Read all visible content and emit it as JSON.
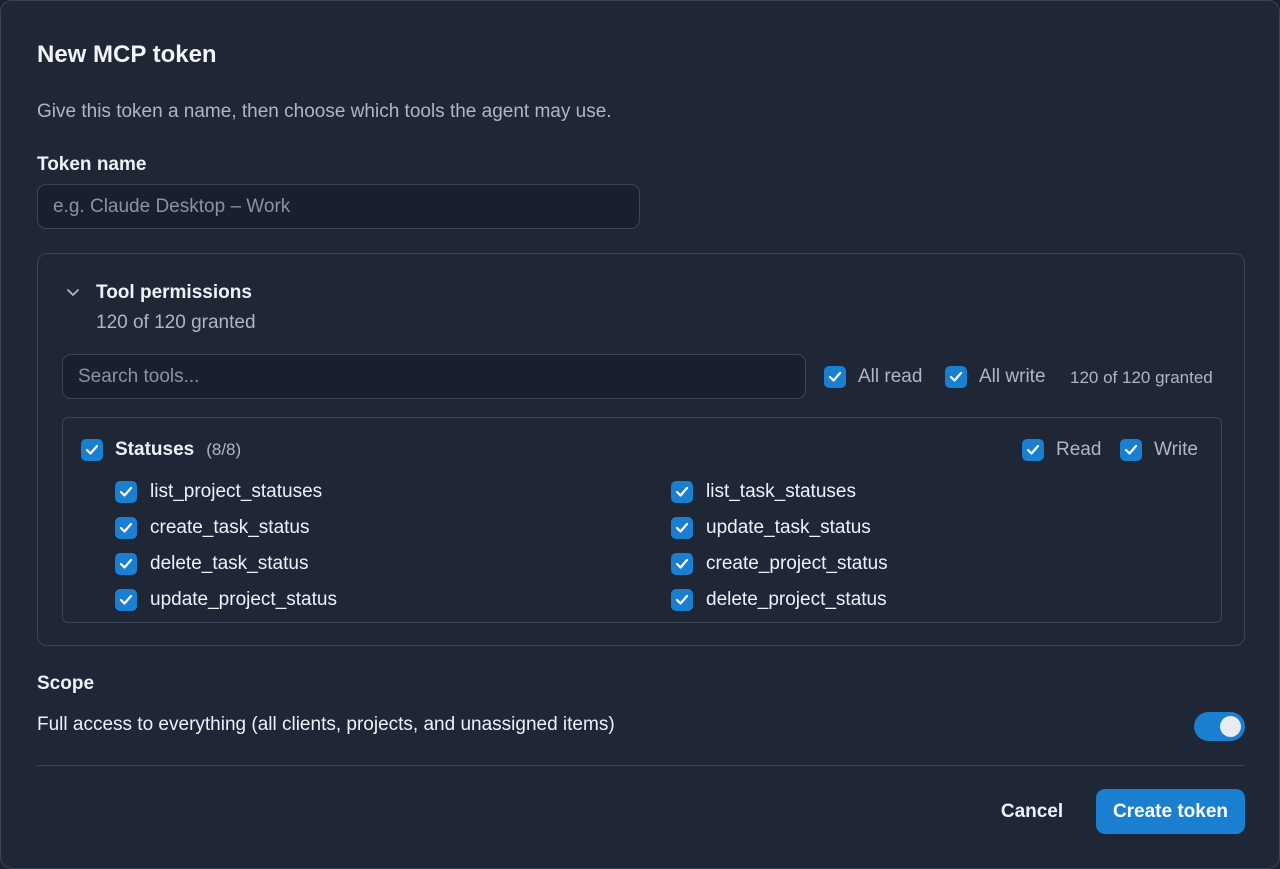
{
  "dialog": {
    "title": "New MCP token",
    "description": "Give this token a name, then choose which tools the agent may use."
  },
  "token_name": {
    "label": "Token name",
    "placeholder": "e.g. Claude Desktop – Work",
    "value": ""
  },
  "permissions": {
    "title": "Tool permissions",
    "summary": "120 of 120 granted",
    "search_placeholder": "Search tools...",
    "all_read_label": "All read",
    "all_read_checked": true,
    "all_write_label": "All write",
    "all_write_checked": true,
    "granted_text": "120 of 120 granted",
    "groups": [
      {
        "name": "Statuses",
        "count": "(8/8)",
        "read_label": "Read",
        "write_label": "Write",
        "tools_left": [
          "list_project_statuses",
          "create_task_status",
          "delete_task_status",
          "update_project_status"
        ],
        "tools_right": [
          "list_task_statuses",
          "update_task_status",
          "create_project_status",
          "delete_project_status"
        ]
      }
    ]
  },
  "scope": {
    "label": "Scope",
    "full_access_text": "Full access to everything (all clients, projects, and unassigned items)",
    "full_access_enabled": true
  },
  "actions": {
    "cancel_label": "Cancel",
    "create_label": "Create token"
  },
  "colors": {
    "accent": "#1a7fd0",
    "background": "#1f2737"
  }
}
